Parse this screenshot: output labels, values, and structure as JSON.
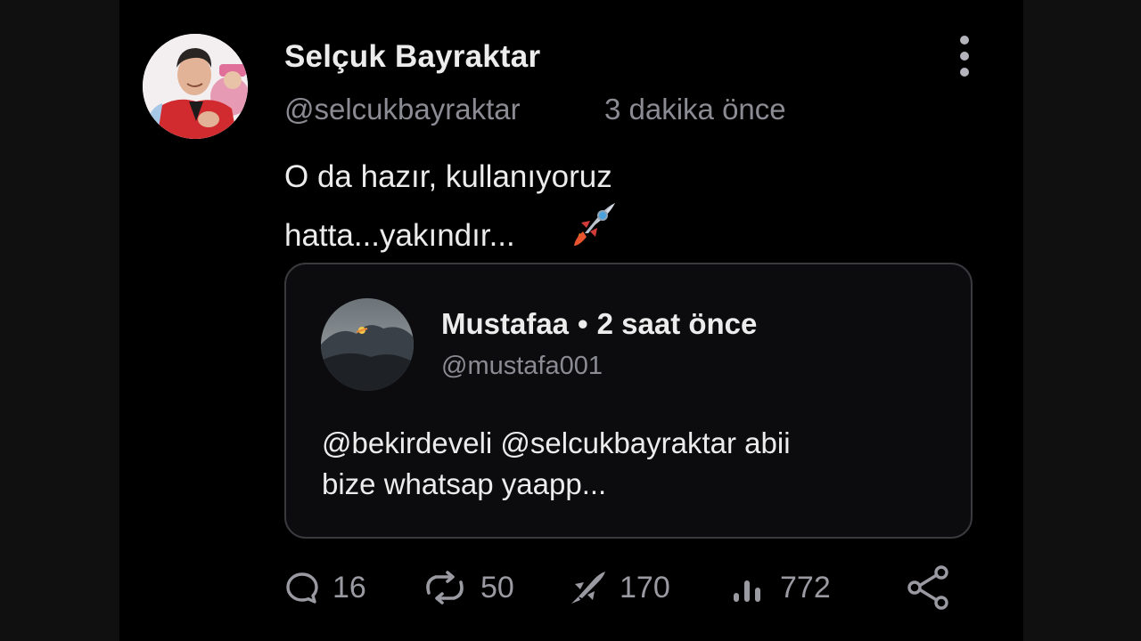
{
  "post": {
    "author_name": "Selçuk Bayraktar",
    "author_handle": "@selcukbayraktar",
    "time": "3 dakika önce",
    "text": "O da hazır, kullanıyoruz\nhatta...yakındır...",
    "emoji": "rocket-emoji"
  },
  "quote": {
    "author_name": "Mustafaa",
    "separator": "•",
    "time": "2 saat önce",
    "handle": "@mustafa001",
    "text": "@bekirdeveli @selcukbayraktar  abii\nbize whatsap yaapp..."
  },
  "actions": {
    "comments": {
      "icon": "comment-icon",
      "count": "16"
    },
    "reposts": {
      "icon": "repost-icon",
      "count": "50"
    },
    "likes": {
      "icon": "rocket-icon",
      "count": "170"
    },
    "views": {
      "icon": "views-icon",
      "count": "772"
    },
    "share": {
      "icon": "share-icon"
    },
    "more": {
      "icon": "more-vertical-icon"
    }
  },
  "colors": {
    "background": "#000000",
    "outer_background": "#101010",
    "text_primary": "#ececec",
    "text_secondary": "#8b8b93",
    "card_border": "#3a3a3e"
  }
}
